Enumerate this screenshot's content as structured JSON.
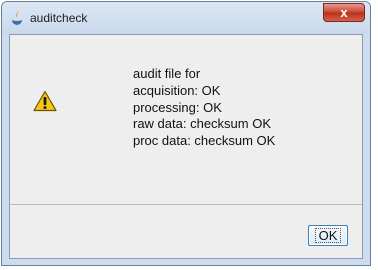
{
  "window": {
    "title": "auditcheck",
    "close_label": "x"
  },
  "dialog": {
    "icon": "warning-icon",
    "message_lines": [
      "audit file for",
      "acquisition: OK",
      "processing: OK",
      "raw data: checksum OK",
      "proc data: checksum OK"
    ],
    "ok_label": "OK"
  },
  "colors": {
    "frame": "#cddcee",
    "client_bg": "#eeeeee",
    "close_button": "#c9432f",
    "warning_fill": "#f5c518"
  }
}
